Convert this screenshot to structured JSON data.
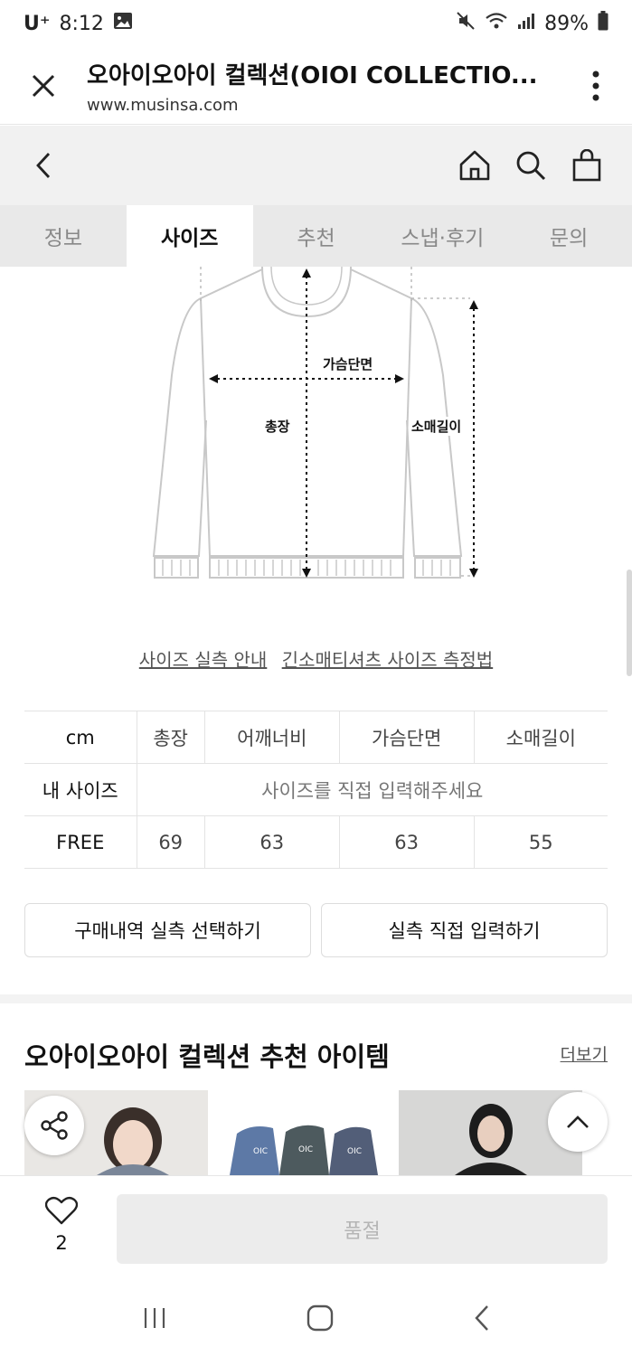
{
  "status_bar": {
    "carrier": "U⁺",
    "time": "8:12",
    "battery": "89%"
  },
  "browser": {
    "title": "오아이오아이 컬렉션(OIOI COLLECTIO...",
    "url": "www.musinsa.com"
  },
  "tabs": [
    {
      "label": "정보"
    },
    {
      "label": "사이즈"
    },
    {
      "label": "추천"
    },
    {
      "label": "스냅·후기"
    },
    {
      "label": "문의"
    }
  ],
  "diagram": {
    "chest_label": "가슴단면",
    "length_label": "총장",
    "sleeve_label": "소매길이"
  },
  "guides": {
    "size_guide": "사이즈 실측 안내",
    "measure_guide": "긴소매티셔츠 사이즈 측정법"
  },
  "size_table": {
    "headers": [
      "cm",
      "총장",
      "어깨너비",
      "가슴단면",
      "소매길이"
    ],
    "my_size_label": "내 사이즈",
    "my_size_hint": "사이즈를 직접 입력해주세요",
    "rows": [
      {
        "size": "FREE",
        "values": [
          "69",
          "63",
          "63",
          "55"
        ]
      }
    ]
  },
  "buttons": {
    "select_purchase": "구매내역 실측 선택하기",
    "direct_input": "실측 직접 입력하기"
  },
  "recommend": {
    "title": "오아이오아이 컬렉션 추천 아이템",
    "more": "더보기"
  },
  "bottom": {
    "like_count": "2",
    "soldout": "품절"
  },
  "colors": {
    "accent": "#111111",
    "tab_bg": "#e9e9e9",
    "nav_bg": "#f1f1f1"
  }
}
